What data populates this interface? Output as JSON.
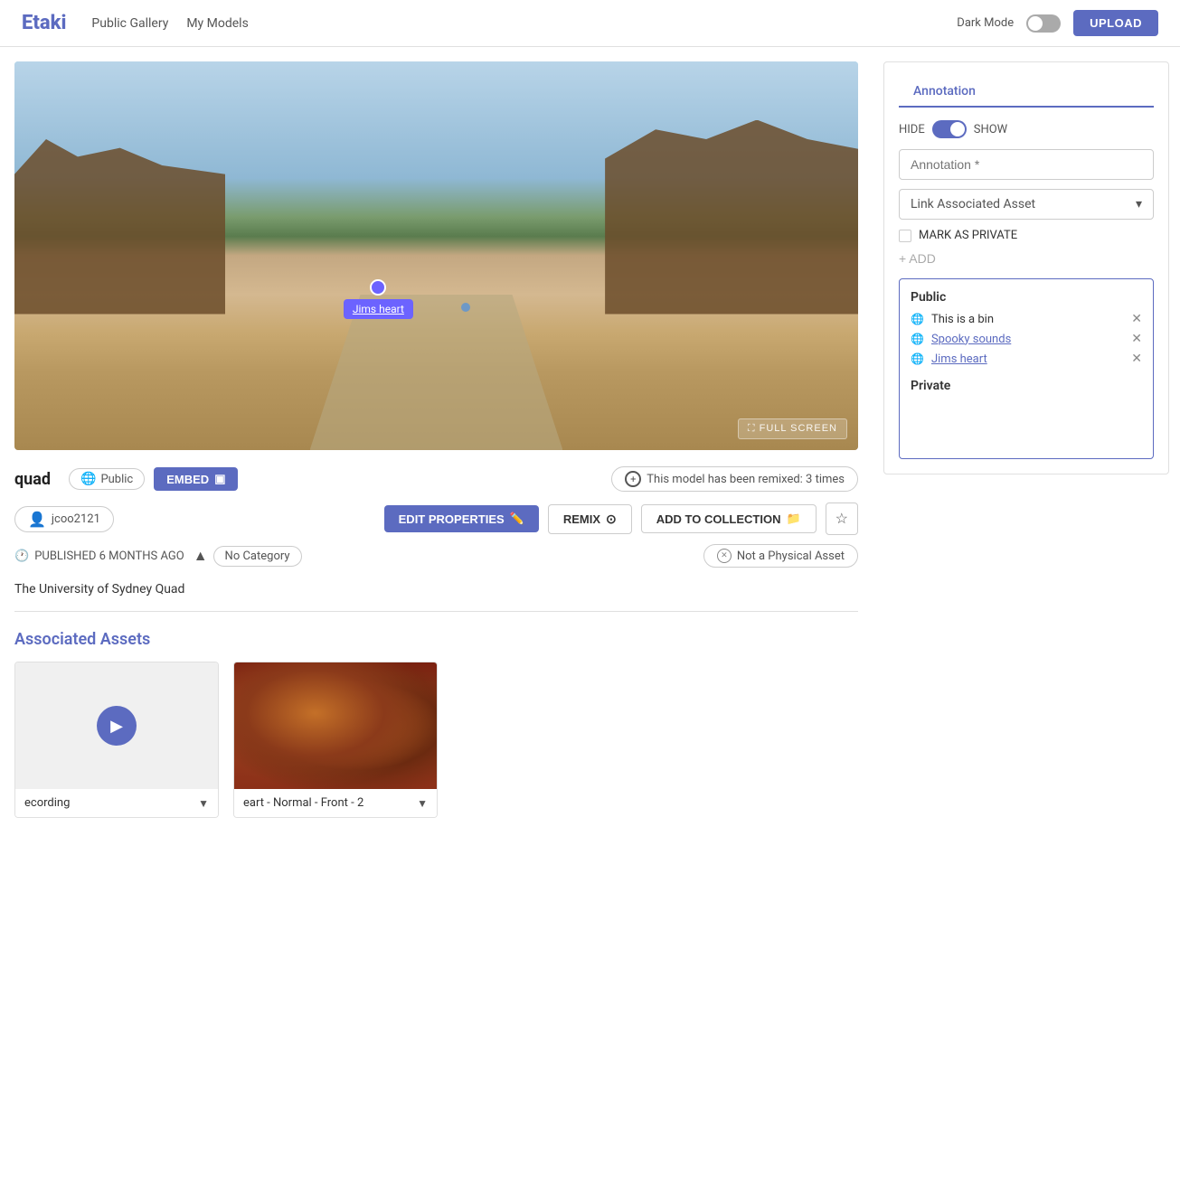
{
  "navbar": {
    "logo": "Etaki",
    "links": [
      "Public Gallery",
      "My Models"
    ],
    "dark_mode_label": "Dark Mode",
    "upload_label": "UPLOAD"
  },
  "viewer": {
    "annotation_pin_label": "Jims heart",
    "fullscreen_label": "⛶ FULL SCREEN"
  },
  "annotation_panel": {
    "tab_label": "Annotation",
    "hide_label": "HIDE",
    "show_label": "SHOW",
    "input_placeholder": "Annotation *",
    "link_asset_label": "Link Associated Asset",
    "mark_private_label": "MARK AS PRIVATE",
    "add_label": "+ ADD",
    "public_section": "Public",
    "private_section": "Private",
    "annotations": [
      {
        "label": "This is a bin",
        "linked": false
      },
      {
        "label": "Spooky sounds",
        "linked": true
      },
      {
        "label": "Jims heart",
        "linked": true
      }
    ]
  },
  "model": {
    "title": "quad",
    "visibility": "Public",
    "embed_label": "EMBED",
    "remix_count": "This model has been remixed: 3 times",
    "user": "jcoo2121",
    "published": "PUBLISHED 6 MONTHS AGO",
    "category": "No Category",
    "physical": "Not a Physical Asset",
    "description": "The University of Sydney Quad",
    "edit_properties_label": "EDIT PROPERTIES",
    "remix_label": "REMIX",
    "add_to_collection_label": "ADD TO COLLECTION"
  },
  "associated_assets": {
    "title": "Associated Assets",
    "items": [
      {
        "label": "ecording",
        "type": "video"
      },
      {
        "label": "eart - Normal - Front - 2",
        "type": "image"
      }
    ]
  }
}
